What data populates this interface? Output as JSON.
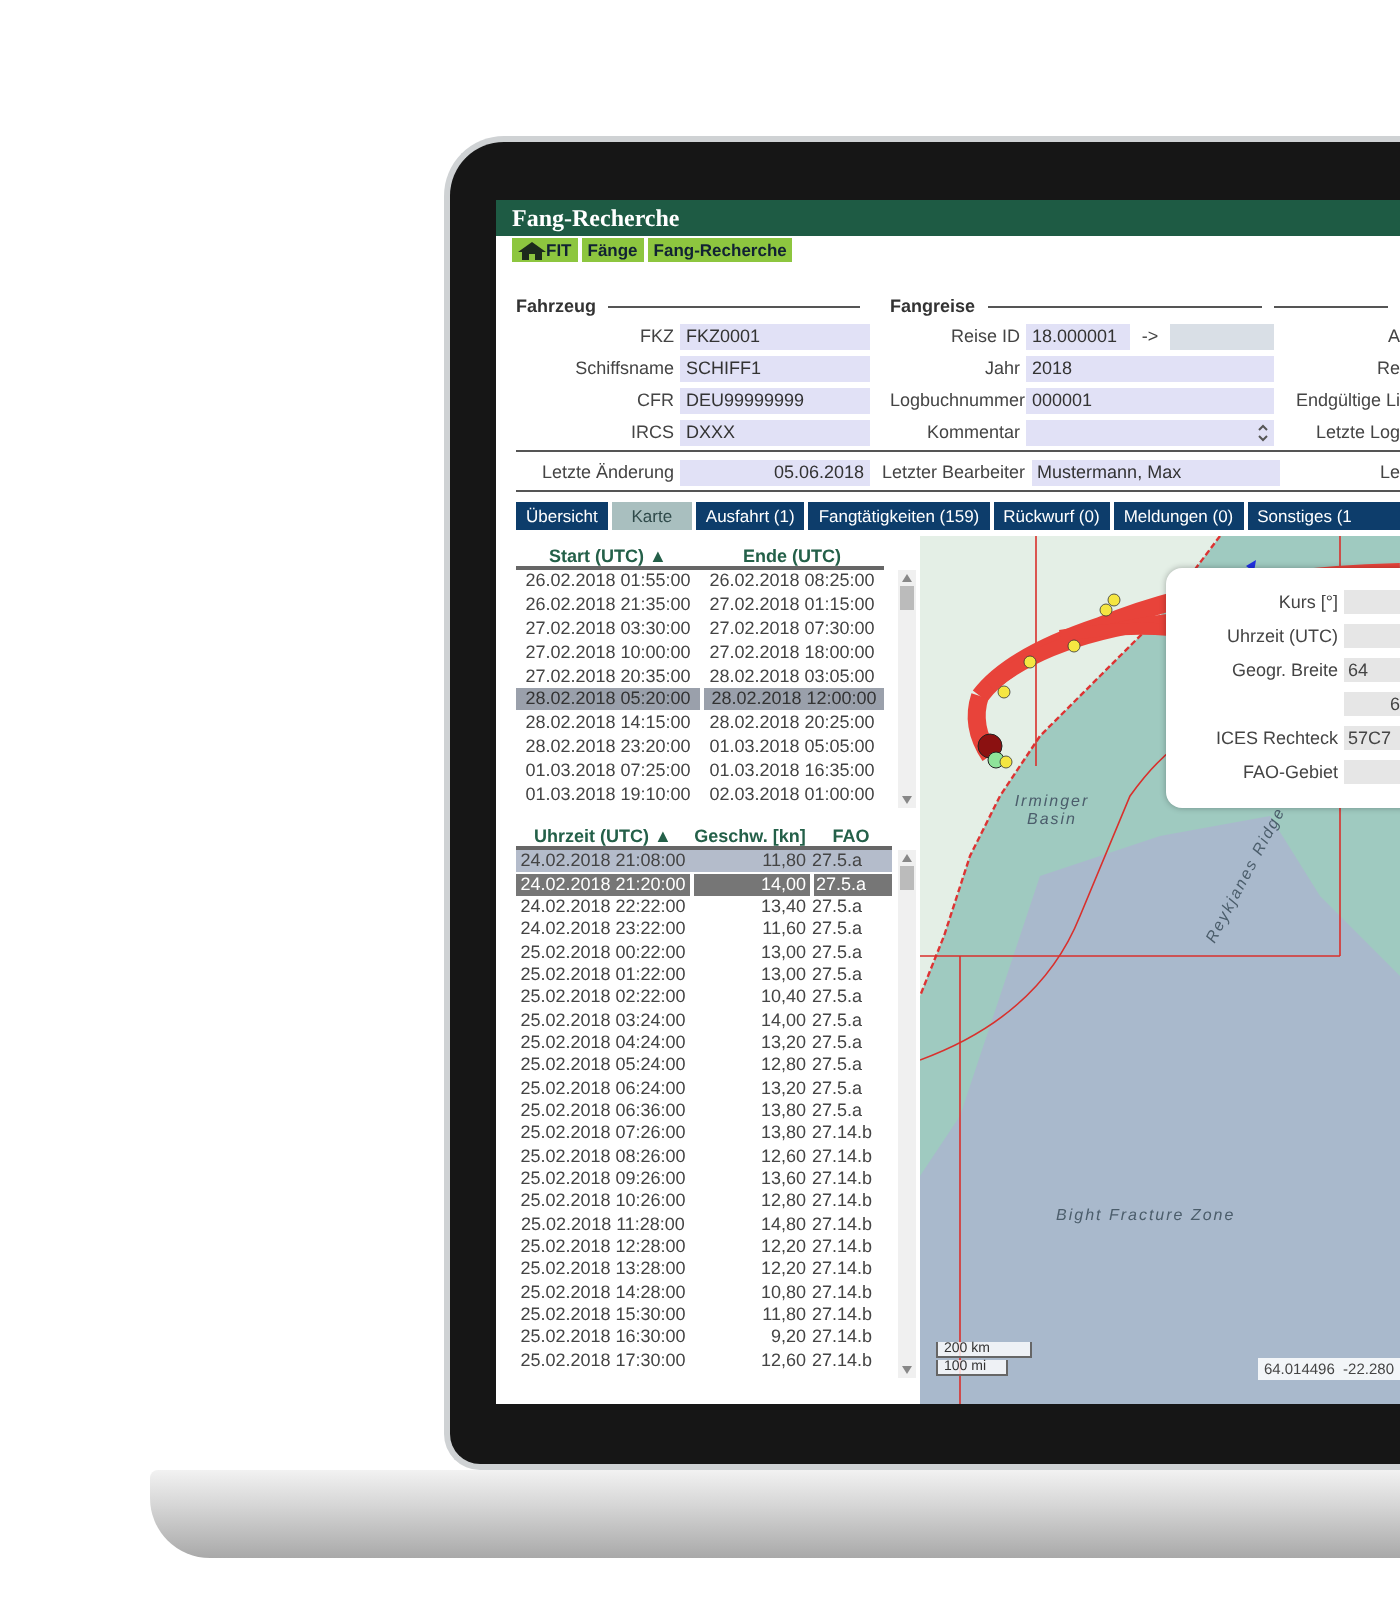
{
  "window": {
    "title": "Fang-Recherche"
  },
  "breadcrumb": [
    "FIT",
    "Fänge",
    "Fang-Recherche"
  ],
  "form": {
    "sections": [
      {
        "title": "Fahrzeug",
        "fields": [
          {
            "label": "FKZ",
            "value": "FKZ0001",
            "kind": "text"
          },
          {
            "label": "Schiffsname",
            "value": "SCHIFF1",
            "kind": "text"
          },
          {
            "label": "CFR",
            "value": "DEU99999999",
            "kind": "text"
          },
          {
            "label": "IRCS",
            "value": "DXXX",
            "kind": "text"
          }
        ]
      },
      {
        "title": "Fangreise",
        "fields": [
          {
            "label": "Reise ID",
            "value": "18.000001",
            "arrow": "->",
            "kind": "range"
          },
          {
            "label": "Jahr",
            "value": "2018",
            "kind": "text"
          },
          {
            "label": "Logbuchnummer",
            "value": "000001",
            "kind": "text"
          },
          {
            "label": "Kommentar",
            "kind": "spinner"
          }
        ]
      },
      {
        "fields": [
          {
            "label": "A",
            "kind": "label"
          },
          {
            "label": "Re",
            "kind": "label"
          },
          {
            "label": "Endgültige Li",
            "kind": "label"
          },
          {
            "label": "Letzte Log",
            "kind": "label"
          }
        ]
      }
    ],
    "footer": [
      {
        "label": "Letzte Änderung",
        "value": "05.06.2018",
        "kind": "date"
      },
      {
        "label": "Letzter Bearbeiter",
        "value": "Mustermann, Max",
        "kind": "text"
      },
      {
        "label": "Le",
        "kind": "label"
      }
    ]
  },
  "tabs": [
    {
      "label": "Übersicht",
      "selected": false
    },
    {
      "label": "Karte",
      "selected": true
    },
    {
      "label": "Ausfahrt (1)",
      "selected": false
    },
    {
      "label": "Fangtätigkeiten (159)",
      "selected": false
    },
    {
      "label": "Rückwurf (0)",
      "selected": false
    },
    {
      "label": "Meldungen (0)",
      "selected": false
    },
    {
      "label": "Sonstiges (1",
      "selected": false
    }
  ],
  "trips": {
    "columns": [
      "Start (UTC) ▲",
      "Ende (UTC)"
    ],
    "rows": [
      {
        "cells": [
          "26.02.2018 01:55:00",
          "26.02.2018 08:25:00"
        ],
        "selected": false
      },
      {
        "cells": [
          "26.02.2018 21:35:00",
          "27.02.2018 01:15:00"
        ],
        "selected": false
      },
      {
        "cells": [
          "27.02.2018 03:30:00",
          "27.02.2018 07:30:00"
        ],
        "selected": false
      },
      {
        "cells": [
          "27.02.2018 10:00:00",
          "27.02.2018 18:00:00"
        ],
        "selected": false
      },
      {
        "cells": [
          "27.02.2018 20:35:00",
          "28.02.2018 03:05:00"
        ],
        "selected": false
      },
      {
        "cells": [
          "28.02.2018 05:20:00",
          "28.02.2018 12:00:00"
        ],
        "selected": true
      },
      {
        "cells": [
          "28.02.2018 14:15:00",
          "28.02.2018 20:25:00"
        ],
        "selected": false
      },
      {
        "cells": [
          "28.02.2018 23:20:00",
          "01.03.2018 05:05:00"
        ],
        "selected": false
      },
      {
        "cells": [
          "01.03.2018 07:25:00",
          "01.03.2018 16:35:00"
        ],
        "selected": false
      },
      {
        "cells": [
          "01.03.2018 19:10:00",
          "02.03.2018 01:00:00"
        ],
        "selected": false
      }
    ]
  },
  "positions": {
    "columns": [
      "Uhrzeit (UTC) ▲",
      "Geschw. [kn]",
      "FAO"
    ],
    "rows": [
      {
        "cells": [
          "24.02.2018 21:08:00",
          "11,80",
          "27.5.a"
        ],
        "selected": false,
        "marked": true
      },
      {
        "cells": [
          "24.02.2018 21:20:00",
          "14,00",
          "27.5.a"
        ],
        "selected": true,
        "marked": false
      },
      {
        "cells": [
          "24.02.2018 22:22:00",
          "13,40",
          "27.5.a"
        ],
        "selected": false,
        "marked": false
      },
      {
        "cells": [
          "24.02.2018 23:22:00",
          "11,60",
          "27.5.a"
        ],
        "selected": false,
        "marked": false
      },
      {
        "cells": [
          "25.02.2018 00:22:00",
          "13,00",
          "27.5.a"
        ],
        "selected": false,
        "marked": false
      },
      {
        "cells": [
          "25.02.2018 01:22:00",
          "13,00",
          "27.5.a"
        ],
        "selected": false,
        "marked": false
      },
      {
        "cells": [
          "25.02.2018 02:22:00",
          "10,40",
          "27.5.a"
        ],
        "selected": false,
        "marked": false
      },
      {
        "cells": [
          "25.02.2018 03:24:00",
          "14,00",
          "27.5.a"
        ],
        "selected": false,
        "marked": false
      },
      {
        "cells": [
          "25.02.2018 04:24:00",
          "13,20",
          "27.5.a"
        ],
        "selected": false,
        "marked": false
      },
      {
        "cells": [
          "25.02.2018 05:24:00",
          "12,80",
          "27.5.a"
        ],
        "selected": false,
        "marked": false
      },
      {
        "cells": [
          "25.02.2018 06:24:00",
          "13,20",
          "27.5.a"
        ],
        "selected": false,
        "marked": false
      },
      {
        "cells": [
          "25.02.2018 06:36:00",
          "13,80",
          "27.5.a"
        ],
        "selected": false,
        "marked": false
      },
      {
        "cells": [
          "25.02.2018 07:26:00",
          "13,80",
          "27.14.b"
        ],
        "selected": false,
        "marked": false
      },
      {
        "cells": [
          "25.02.2018 08:26:00",
          "12,60",
          "27.14.b"
        ],
        "selected": false,
        "marked": false
      },
      {
        "cells": [
          "25.02.2018 09:26:00",
          "13,60",
          "27.14.b"
        ],
        "selected": false,
        "marked": false
      },
      {
        "cells": [
          "25.02.2018 10:26:00",
          "12,80",
          "27.14.b"
        ],
        "selected": false,
        "marked": false
      },
      {
        "cells": [
          "25.02.2018 11:28:00",
          "14,80",
          "27.14.b"
        ],
        "selected": false,
        "marked": false
      },
      {
        "cells": [
          "25.02.2018 12:28:00",
          "12,20",
          "27.14.b"
        ],
        "selected": false,
        "marked": false
      },
      {
        "cells": [
          "25.02.2018 13:28:00",
          "12,20",
          "27.14.b"
        ],
        "selected": false,
        "marked": false
      },
      {
        "cells": [
          "25.02.2018 14:28:00",
          "10,80",
          "27.14.b"
        ],
        "selected": false,
        "marked": false
      },
      {
        "cells": [
          "25.02.2018 15:30:00",
          "11,80",
          "27.14.b"
        ],
        "selected": false,
        "marked": false
      },
      {
        "cells": [
          "25.02.2018 16:30:00",
          "9,20",
          "27.14.b"
        ],
        "selected": false,
        "marked": false
      },
      {
        "cells": [
          "25.02.2018 17:30:00",
          "12,60",
          "27.14.b"
        ],
        "selected": false,
        "marked": false
      }
    ]
  },
  "map": {
    "labels": [
      "Irminger Basin",
      "Reykjanes Ridge",
      "Bight Fracture Zone"
    ],
    "popup": {
      "fields": [
        {
          "label": "Kurs [°]"
        },
        {
          "label": "Uhrzeit (UTC)"
        },
        {
          "label": "Geogr. Breite",
          "value": "64"
        },
        {
          "value": "6"
        },
        {
          "label": "ICES Rechteck",
          "value": "57C7"
        },
        {
          "label": "FAO-Gebiet"
        }
      ]
    },
    "scale": [
      "200 km",
      "100 mi"
    ],
    "coordinates": "64.014496  -22.280"
  }
}
